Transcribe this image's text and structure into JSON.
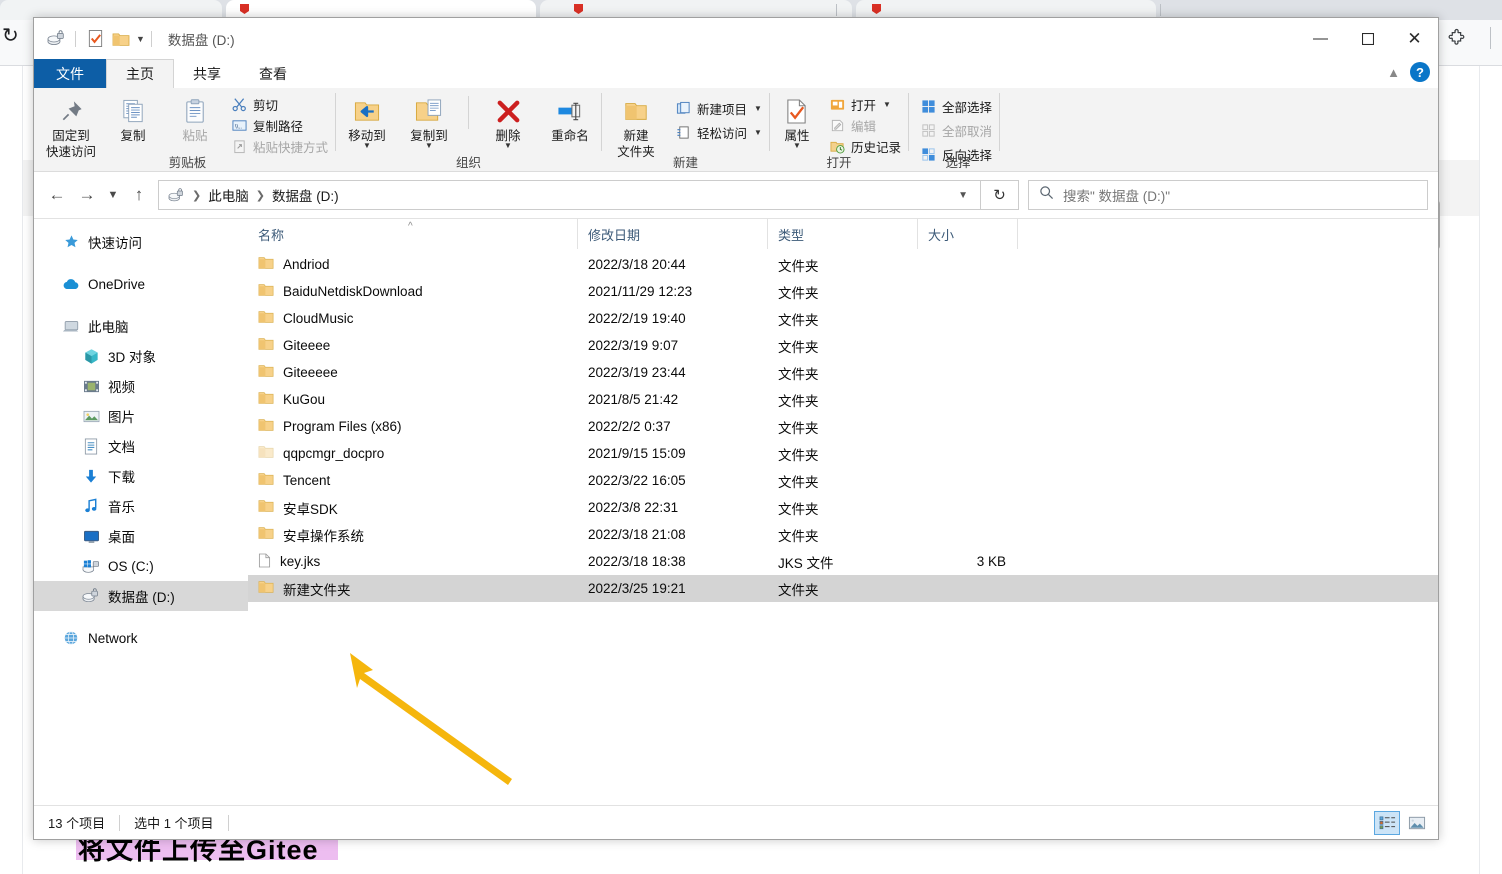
{
  "background": {
    "reload_icon": "reload-icon",
    "extensions_icon": "puzzle-icon",
    "annotation_text": "将文件上传至Gitee"
  },
  "window": {
    "title": "数据盘 (D:)",
    "quick_access": [
      {
        "name": "drive-icon",
        "glyph": "drive"
      },
      {
        "name": "properties-icon",
        "glyph": "check-doc"
      },
      {
        "name": "new-folder-icon",
        "glyph": "folder"
      },
      {
        "name": "customize-caret-icon",
        "glyph": "▾"
      }
    ],
    "controls": {
      "minimize": "—",
      "maximize": "▢",
      "close": "✕"
    }
  },
  "ribbon": {
    "tabs": [
      {
        "label": "文件",
        "style": "file"
      },
      {
        "label": "主页",
        "style": "active"
      },
      {
        "label": "共享",
        "style": "normal"
      },
      {
        "label": "查看",
        "style": "normal"
      }
    ],
    "collapse_icon": "chevron-up-icon",
    "help_label": "?",
    "groups": [
      {
        "label": "剪贴板",
        "big": [
          {
            "label_line1": "固定到",
            "label_line2": "快速访问",
            "icon": "pin-icon",
            "disabled": false
          },
          {
            "label_line1": "复制",
            "label_line2": "",
            "icon": "copy-icon",
            "disabled": false
          },
          {
            "label_line1": "粘贴",
            "label_line2": "",
            "icon": "paste-icon",
            "disabled": true
          }
        ],
        "small": [
          {
            "label": "剪切",
            "icon": "scissors-icon",
            "disabled": false
          },
          {
            "label": "复制路径",
            "icon": "copy-path-icon",
            "disabled": false
          },
          {
            "label": "粘贴快捷方式",
            "icon": "paste-shortcut-icon",
            "disabled": true
          }
        ]
      },
      {
        "label": "组织",
        "big": [
          {
            "label_line1": "移动到",
            "label_line2": "",
            "icon": "move-to-icon",
            "dropdown": true
          },
          {
            "label_line1": "复制到",
            "label_line2": "",
            "icon": "copy-to-icon",
            "dropdown": true
          },
          {
            "label_line1": "删除",
            "label_line2": "",
            "icon": "delete-icon",
            "dropdown": true
          },
          {
            "label_line1": "重命名",
            "label_line2": "",
            "icon": "rename-icon",
            "dropdown": false
          }
        ],
        "small": []
      },
      {
        "label": "新建",
        "big": [
          {
            "label_line1": "新建",
            "label_line2": "文件夹",
            "icon": "new-folder-icon",
            "dropdown": false
          }
        ],
        "small": [
          {
            "label": "新建项目",
            "icon": "new-item-icon",
            "caret": true
          },
          {
            "label": "轻松访问",
            "icon": "easy-access-icon",
            "caret": true
          }
        ]
      },
      {
        "label": "打开",
        "big": [
          {
            "label_line1": "属性",
            "label_line2": "",
            "icon": "properties-icon",
            "dropdown": true
          }
        ],
        "small": [
          {
            "label": "打开",
            "icon": "open-icon",
            "caret": true,
            "disabled": false
          },
          {
            "label": "编辑",
            "icon": "edit-icon",
            "caret": false,
            "disabled": true
          },
          {
            "label": "历史记录",
            "icon": "history-icon",
            "caret": false,
            "disabled": false
          }
        ]
      },
      {
        "label": "选择",
        "big": [],
        "small": [
          {
            "label": "全部选择",
            "icon": "select-all-icon",
            "disabled": false
          },
          {
            "label": "全部取消",
            "icon": "select-none-icon",
            "disabled": true
          },
          {
            "label": "反向选择",
            "icon": "invert-selection-icon",
            "disabled": false
          }
        ]
      }
    ]
  },
  "addressbar": {
    "back_icon": "arrow-left-icon",
    "forward_icon": "arrow-right-icon",
    "recent_icon": "chevron-down-icon",
    "up_icon": "arrow-up-icon",
    "drive_icon": "drive-icon",
    "breadcrumbs": [
      "此电脑",
      "数据盘 (D:)"
    ],
    "dropdown_icon": "chevron-down-icon",
    "refresh_icon": "refresh-icon",
    "search_icon": "search-icon",
    "search_placeholder": "搜索\" 数据盘 (D:)\"",
    "search_value": ""
  },
  "sidebar": {
    "items": [
      {
        "label": "快速访问",
        "icon": "star-pin-icon",
        "indent": false,
        "selected": false,
        "gap": false
      },
      {
        "label": "OneDrive",
        "icon": "cloud-icon",
        "indent": false,
        "selected": false,
        "gap": true
      },
      {
        "label": "此电脑",
        "icon": "pc-icon",
        "indent": false,
        "selected": false,
        "gap": true
      },
      {
        "label": "3D 对象",
        "icon": "cube-icon",
        "indent": true,
        "selected": false,
        "gap": false
      },
      {
        "label": "视频",
        "icon": "video-icon",
        "indent": true,
        "selected": false,
        "gap": false
      },
      {
        "label": "图片",
        "icon": "pictures-icon",
        "indent": true,
        "selected": false,
        "gap": false
      },
      {
        "label": "文档",
        "icon": "documents-icon",
        "indent": true,
        "selected": false,
        "gap": false
      },
      {
        "label": "下载",
        "icon": "downloads-icon",
        "indent": true,
        "selected": false,
        "gap": false
      },
      {
        "label": "音乐",
        "icon": "music-icon",
        "indent": true,
        "selected": false,
        "gap": false
      },
      {
        "label": "桌面",
        "icon": "desktop-icon",
        "indent": true,
        "selected": false,
        "gap": false
      },
      {
        "label": "OS (C:)",
        "icon": "os-drive-icon",
        "indent": true,
        "selected": false,
        "gap": false
      },
      {
        "label": "数据盘 (D:)",
        "icon": "drive-icon",
        "indent": true,
        "selected": true,
        "gap": false
      },
      {
        "label": "Network",
        "icon": "network-icon",
        "indent": false,
        "selected": false,
        "gap": true
      }
    ]
  },
  "filelist": {
    "columns": [
      {
        "key": "name",
        "label": "名称"
      },
      {
        "key": "date",
        "label": "修改日期"
      },
      {
        "key": "type",
        "label": "类型"
      },
      {
        "key": "size",
        "label": "大小"
      }
    ],
    "sort_indicator": "^",
    "rows": [
      {
        "name": "Andriod",
        "date": "2022/3/18 20:44",
        "type": "文件夹",
        "size": "",
        "icon": "folder-icon",
        "selected": false
      },
      {
        "name": "BaiduNetdiskDownload",
        "date": "2021/11/29 12:23",
        "type": "文件夹",
        "size": "",
        "icon": "folder-icon",
        "selected": false
      },
      {
        "name": "CloudMusic",
        "date": "2022/2/19 19:40",
        "type": "文件夹",
        "size": "",
        "icon": "folder-icon",
        "selected": false
      },
      {
        "name": "Giteeee",
        "date": "2022/3/19 9:07",
        "type": "文件夹",
        "size": "",
        "icon": "folder-icon",
        "selected": false
      },
      {
        "name": "Giteeeee",
        "date": "2022/3/19 23:44",
        "type": "文件夹",
        "size": "",
        "icon": "folder-icon",
        "selected": false
      },
      {
        "name": "KuGou",
        "date": "2021/8/5 21:42",
        "type": "文件夹",
        "size": "",
        "icon": "folder-icon",
        "selected": false
      },
      {
        "name": "Program Files (x86)",
        "date": "2022/2/2 0:37",
        "type": "文件夹",
        "size": "",
        "icon": "folder-icon",
        "selected": false
      },
      {
        "name": "qqpcmgr_docpro",
        "date": "2021/9/15 15:09",
        "type": "文件夹",
        "size": "",
        "icon": "folder-dim-icon",
        "selected": false
      },
      {
        "name": "Tencent",
        "date": "2022/3/22 16:05",
        "type": "文件夹",
        "size": "",
        "icon": "folder-icon",
        "selected": false
      },
      {
        "name": "安卓SDK",
        "date": "2022/3/8 22:31",
        "type": "文件夹",
        "size": "",
        "icon": "folder-icon",
        "selected": false
      },
      {
        "name": "安卓操作系统",
        "date": "2022/3/18 21:08",
        "type": "文件夹",
        "size": "",
        "icon": "folder-icon",
        "selected": false
      },
      {
        "name": "key.jks",
        "date": "2022/3/18 18:38",
        "type": "JKS 文件",
        "size": "3 KB",
        "icon": "file-icon",
        "selected": false
      },
      {
        "name": "新建文件夹",
        "date": "2022/3/25 19:21",
        "type": "文件夹",
        "size": "",
        "icon": "folder-icon",
        "selected": true
      }
    ]
  },
  "statusbar": {
    "item_count": "13 个项目",
    "selection": "选中 1 个项目",
    "views": [
      {
        "name": "details-view-button",
        "active": true
      },
      {
        "name": "large-icons-view-button",
        "active": false
      }
    ]
  },
  "colors": {
    "accent": "#0d5ea6",
    "selection": "#d4d4d4",
    "folder": "#f7d189",
    "arrow": "#f5b60d",
    "highlight": "#edbdf0"
  }
}
